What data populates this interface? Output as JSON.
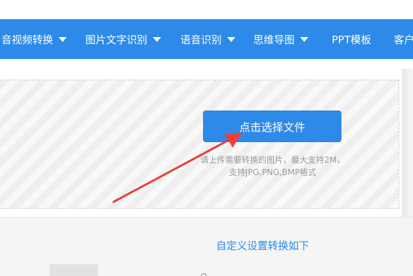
{
  "nav": {
    "items": [
      {
        "label": "音视频转换",
        "has_dropdown": true
      },
      {
        "label": "图片文字识别",
        "has_dropdown": true
      },
      {
        "label": "语音识别",
        "has_dropdown": true
      },
      {
        "label": "思维导图",
        "has_dropdown": true
      },
      {
        "label": "PPT模板",
        "has_dropdown": false
      },
      {
        "label": "客户",
        "has_dropdown": false
      }
    ]
  },
  "upload": {
    "button_label": "点击选择文件",
    "hint_line1": "请上传需要转换的图片，最大支持2M，",
    "hint_line2": "支持JPG,PNG,BMP格式"
  },
  "settings": {
    "title": "自定义设置转换如下"
  },
  "colors": {
    "accent": "#2d8ae8",
    "arrow": "#e8403a"
  }
}
